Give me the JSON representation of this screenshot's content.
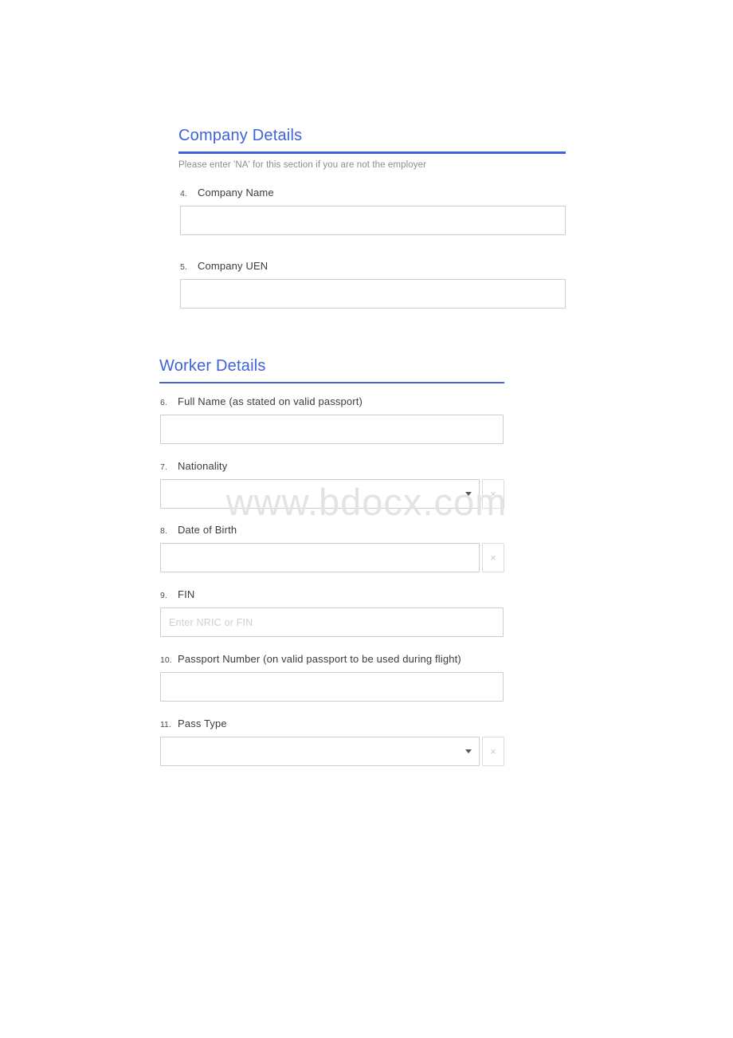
{
  "watermark": {
    "text": "www.bdocx.com"
  },
  "sections": [
    {
      "title": "Company Details",
      "subtitle": "Please enter 'NA' for this section if you are not the employer",
      "questions": [
        {
          "number": "4.",
          "label": "Company Name",
          "type": "text",
          "value": "",
          "placeholder": ""
        },
        {
          "number": "5.",
          "label": "Company UEN",
          "type": "text",
          "value": "",
          "placeholder": ""
        }
      ]
    },
    {
      "title": "Worker Details",
      "subtitle": "",
      "questions": [
        {
          "number": "6.",
          "label": "Full Name (as stated on valid passport)",
          "type": "text",
          "value": "",
          "placeholder": ""
        },
        {
          "number": "7.",
          "label": "Nationality",
          "type": "select",
          "value": "",
          "placeholder": "",
          "clear_label": "×"
        },
        {
          "number": "8.",
          "label": "Date of Birth",
          "type": "text-clear",
          "value": "",
          "placeholder": "",
          "clear_label": "×"
        },
        {
          "number": "9.",
          "label": "FIN",
          "type": "text",
          "value": "",
          "placeholder": "Enter NRIC or FIN"
        },
        {
          "number": "10.",
          "label": "Passport Number (on valid passport to be used during flight)",
          "type": "text",
          "value": "",
          "placeholder": ""
        },
        {
          "number": "11.",
          "label": "Pass Type",
          "type": "select",
          "value": "",
          "placeholder": "",
          "clear_label": "×"
        }
      ]
    }
  ],
  "colors": {
    "heading": "#3f62d8",
    "rule": "#3f62d8",
    "label": "#3c3c3c",
    "subtitle": "#8c8c8c",
    "border": "#cccccc",
    "placeholder": "#cfcfcf",
    "watermark": "#e3e3e3"
  }
}
